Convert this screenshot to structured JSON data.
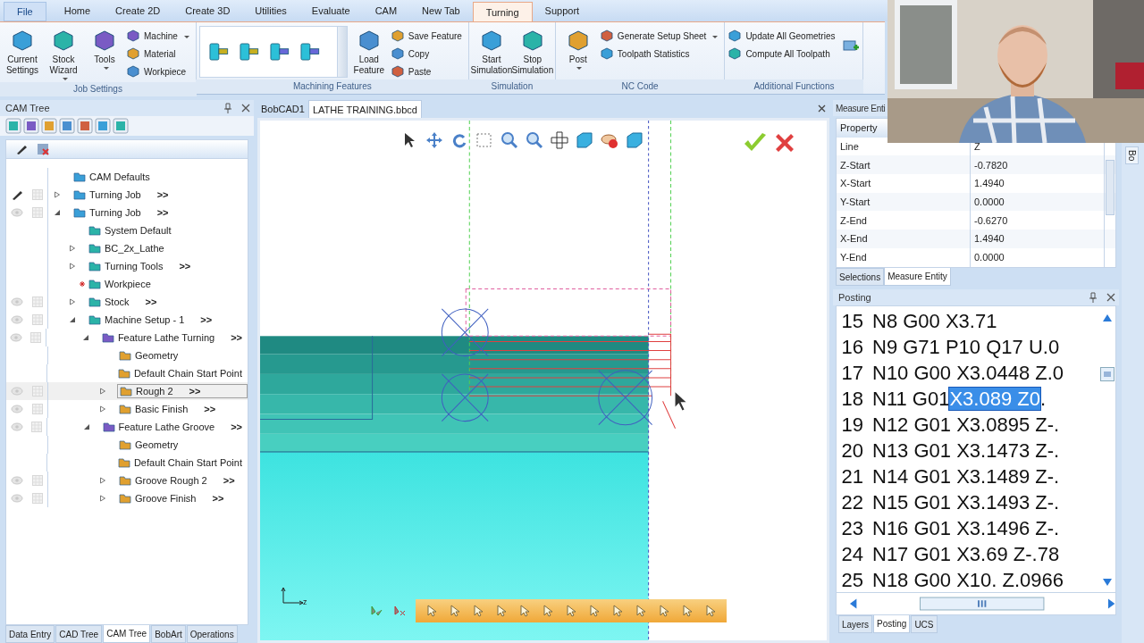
{
  "menu_tabs": [
    {
      "label": "File",
      "selected": false
    },
    {
      "label": "Home",
      "selected": false
    },
    {
      "label": "Create 2D",
      "selected": false
    },
    {
      "label": "Create 3D",
      "selected": false
    },
    {
      "label": "Utilities",
      "selected": false
    },
    {
      "label": "Evaluate",
      "selected": false
    },
    {
      "label": "CAM",
      "selected": false
    },
    {
      "label": "New Tab",
      "selected": false
    },
    {
      "label": "Turning",
      "selected": true
    },
    {
      "label": "Support",
      "selected": false
    }
  ],
  "ribbon_groups": [
    {
      "label": "Job Settings",
      "items": [
        {
          "kind": "large",
          "label": "Current Settings",
          "dropdown": false
        },
        {
          "kind": "large",
          "label": "Stock Wizard",
          "dropdown": true
        },
        {
          "kind": "large",
          "label": "Tools",
          "dropdown": true
        },
        {
          "kind": "stack",
          "entries": [
            {
              "label": "Machine",
              "dropdown": true
            },
            {
              "label": "Material",
              "dropdown": false
            },
            {
              "label": "Workpiece",
              "dropdown": false
            }
          ]
        }
      ]
    },
    {
      "label": "Machining Features",
      "items": [
        {
          "kind": "gallery"
        },
        {
          "kind": "large",
          "label": "Load Feature",
          "dropdown": false
        },
        {
          "kind": "stack",
          "entries": [
            {
              "label": "Save Feature",
              "dropdown": false
            },
            {
              "label": "Copy",
              "dropdown": false
            },
            {
              "label": "Paste",
              "dropdown": false
            }
          ]
        }
      ]
    },
    {
      "label": "Simulation",
      "items": [
        {
          "kind": "large",
          "label": "Start Simulation",
          "dropdown": false
        },
        {
          "kind": "large",
          "label": "Stop Simulation",
          "dropdown": false
        }
      ]
    },
    {
      "label": "NC Code",
      "items": [
        {
          "kind": "large",
          "label": "Post",
          "dropdown": true
        },
        {
          "kind": "stack",
          "entries": [
            {
              "label": "Generate Setup Sheet",
              "dropdown": true
            },
            {
              "label": "Toolpath Statistics",
              "dropdown": false
            }
          ]
        }
      ]
    },
    {
      "label": "Additional Functions",
      "items": [
        {
          "kind": "stack",
          "entries": [
            {
              "label": "Update All Geometries",
              "dropdown": false
            },
            {
              "label": "Compute All Toolpath",
              "dropdown": false
            }
          ]
        },
        {
          "kind": "icon"
        }
      ]
    }
  ],
  "left_panel": {
    "title": "CAM Tree"
  },
  "tree": {
    "items": [
      {
        "label": "CAM Defaults",
        "selected": false,
        "marked": false
      },
      {
        "label": "Turning Job",
        "suffix": ">>",
        "expanded": false,
        "selected": false,
        "marked": false,
        "kind": "pen"
      },
      {
        "label": "Turning Job",
        "suffix": ">>",
        "expanded": true,
        "selected": false,
        "marked": false,
        "kind": "eye",
        "children": [
          {
            "label": "System Default",
            "selected": false,
            "marked": false
          },
          {
            "label": "BC_2x_Lathe",
            "expanded": false,
            "selected": false,
            "marked": false
          },
          {
            "label": "Turning Tools",
            "suffix": ">>",
            "expanded": false,
            "selected": false,
            "marked": false
          },
          {
            "label": "Workpiece",
            "selected": false,
            "marked": true
          },
          {
            "label": "Stock",
            "suffix": ">>",
            "expanded": false,
            "selected": false,
            "marked": false,
            "kind": "eye"
          },
          {
            "label": "Machine Setup - 1",
            "suffix": ">>",
            "expanded": true,
            "selected": false,
            "marked": false,
            "kind": "eye",
            "children": [
              {
                "label": "Feature Lathe Turning",
                "suffix": ">>",
                "expanded": true,
                "selected": false,
                "marked": false,
                "kind": "eye",
                "children": [
                  {
                    "label": "Geometry",
                    "selected": false,
                    "marked": false
                  },
                  {
                    "label": "Default Chain Start Point",
                    "selected": false,
                    "marked": false
                  },
                  {
                    "label": "Rough 2",
                    "suffix": ">>",
                    "expanded": false,
                    "selected": true,
                    "marked": false,
                    "kind": "eye"
                  },
                  {
                    "label": "Basic Finish",
                    "suffix": ">>",
                    "expanded": false,
                    "selected": false,
                    "marked": false,
                    "kind": "eye"
                  }
                ]
              },
              {
                "label": "Feature Lathe Groove",
                "suffix": ">>",
                "expanded": true,
                "selected": false,
                "marked": false,
                "kind": "eye",
                "children": [
                  {
                    "label": "Geometry",
                    "selected": false,
                    "marked": false
                  },
                  {
                    "label": "Default Chain Start Point",
                    "selected": false,
                    "marked": false
                  },
                  {
                    "label": "Groove Rough 2",
                    "suffix": ">>",
                    "expanded": false,
                    "selected": false,
                    "marked": false,
                    "kind": "eye"
                  },
                  {
                    "label": "Groove Finish",
                    "suffix": ">>",
                    "expanded": false,
                    "selected": false,
                    "marked": false,
                    "kind": "eye"
                  }
                ]
              }
            ]
          }
        ]
      }
    ]
  },
  "left_tabs": [
    {
      "label": "Data Entry",
      "selected": false
    },
    {
      "label": "CAD Tree",
      "selected": false
    },
    {
      "label": "CAM Tree",
      "selected": true
    },
    {
      "label": "BobArt",
      "selected": false
    },
    {
      "label": "Operations",
      "selected": false
    }
  ],
  "documents": [
    {
      "label": "BobCAD1",
      "selected": false
    },
    {
      "label": "LATHE TRAINING.bbcd",
      "selected": true
    }
  ],
  "viewport": {
    "axis_label": "z"
  },
  "measure_panel": {
    "title": "Measure Enti",
    "column": "Property",
    "rows": [
      {
        "name": "Line",
        "value": "Z"
      },
      {
        "name": "Z-Start",
        "value": "-0.7820"
      },
      {
        "name": "X-Start",
        "value": "1.4940"
      },
      {
        "name": "Y-Start",
        "value": "0.0000"
      },
      {
        "name": "Z-End",
        "value": "-0.6270"
      },
      {
        "name": "X-End",
        "value": "1.4940"
      },
      {
        "name": "Y-End",
        "value": "0.0000"
      }
    ],
    "tabs": [
      {
        "label": "Selections",
        "selected": false
      },
      {
        "label": "Measure Entity",
        "selected": true
      }
    ]
  },
  "side_strip": {
    "label": "Bo"
  },
  "posting": {
    "title": "Posting",
    "lines": [
      {
        "number": "15",
        "code": "N8 G00 X3.71"
      },
      {
        "number": "16",
        "code": "N9 G71 P10 Q17 U.0"
      },
      {
        "number": "17",
        "code": "N10 G00 X3.0448 Z.0"
      },
      {
        "number": "18",
        "code": "N11 G01",
        "selection": "X3.089 Z0",
        "tail": "."
      },
      {
        "number": "19",
        "code": "N12 G01 X3.0895 Z-."
      },
      {
        "number": "20",
        "code": "N13 G01 X3.1473 Z-."
      },
      {
        "number": "21",
        "code": "N14 G01 X3.1489 Z-."
      },
      {
        "number": "22",
        "code": "N15 G01 X3.1493 Z-."
      },
      {
        "number": "23",
        "code": "N16 G01 X3.1496 Z-."
      },
      {
        "number": "24",
        "code": "N17 G01 X3.69 Z-.78"
      },
      {
        "number": "25",
        "code": "N18 G00 X10. Z.0966"
      }
    ]
  },
  "right_tabs": [
    {
      "label": "Layers",
      "selected": false
    },
    {
      "label": "Posting",
      "selected": true
    },
    {
      "label": "UCS",
      "selected": false
    }
  ]
}
